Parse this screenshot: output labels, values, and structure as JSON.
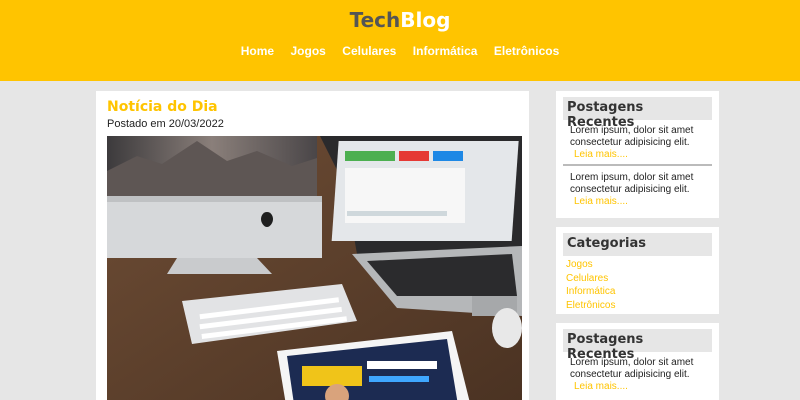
{
  "header": {
    "logo_part1": "Tech",
    "logo_part2": "Blog",
    "nav": [
      "Home",
      "Jogos",
      "Celulares",
      "Informática",
      "Eletrônicos"
    ]
  },
  "post": {
    "title": "Notícia do Dia",
    "date": "Postado em 20/03/2022"
  },
  "widgets": {
    "recent1": {
      "title": "Postagens Recentes",
      "items": [
        {
          "text": "Lorem ipsum, dolor sit amet consectetur adipisicing elit.",
          "more": "Leia mais...."
        },
        {
          "text": "Lorem ipsum, dolor sit amet consectetur adipisicing elit.",
          "more": "Leia mais...."
        }
      ]
    },
    "categories": {
      "title": "Categorias",
      "items": [
        "Jogos",
        "Celulares",
        "Informática",
        "Eletrônicos"
      ]
    },
    "recent2": {
      "title": "Postagens Recentes",
      "items": [
        {
          "text": "Lorem ipsum, dolor sit amet consectetur adipisicing elit.",
          "more": "Leia mais...."
        }
      ]
    }
  },
  "colors": {
    "accent": "#ffc400",
    "background": "#e6e6e6"
  }
}
